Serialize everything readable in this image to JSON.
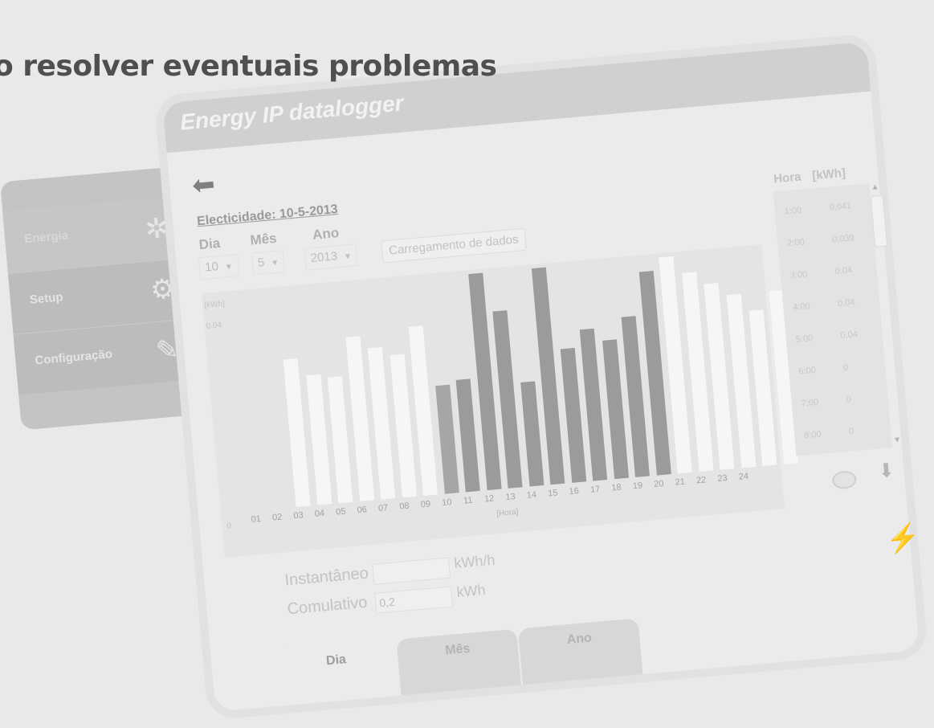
{
  "heading": "o resolver eventuais problemas",
  "app": {
    "title": "Energy IP datalogger",
    "back_icon": "back-arrow-icon"
  },
  "sidebar": {
    "items": [
      {
        "label": "Energia",
        "icon": "energy-icon"
      },
      {
        "label": "Setup",
        "icon": "gear-icon"
      },
      {
        "label": "Configuração",
        "icon": "pencil-icon"
      }
    ]
  },
  "header": {
    "title": "Electicidade: 10-5-2013"
  },
  "selectors": {
    "day_label": "Dia",
    "day_value": "10",
    "month_label": "Mês",
    "month_value": "5",
    "year_label": "Ano",
    "year_value": "2013",
    "load_button": "Carregamento de dados"
  },
  "chart_data": {
    "type": "bar",
    "ylabel": "[kWh]",
    "xlabel": "[Hora]",
    "y_ticks": [
      "0",
      "0.04"
    ],
    "ylim": [
      0,
      0.05
    ],
    "categories": [
      "01",
      "02",
      "03",
      "04",
      "05",
      "06",
      "07",
      "08",
      "09",
      "10",
      "11",
      "12",
      "13",
      "14",
      "15",
      "16",
      "17",
      "18",
      "19",
      "20",
      "21",
      "22",
      "23",
      "24"
    ],
    "values": [
      0.034,
      0.03,
      0.029,
      0.038,
      0.035,
      0.033,
      0.039,
      0.025,
      0.026,
      0.05,
      0.041,
      0.024,
      0.05,
      0.031,
      0.035,
      0.032,
      0.037,
      0.047,
      0.05,
      0.046,
      0.043,
      0.04,
      0.036,
      0.04
    ],
    "bar_tones": [
      "light",
      "light",
      "light",
      "light",
      "light",
      "light",
      "light",
      "mid",
      "dark",
      "dark",
      "dark",
      "dark",
      "dark",
      "dark",
      "dark",
      "dark",
      "dark",
      "dark",
      "light",
      "light",
      "light",
      "light",
      "light",
      "light"
    ]
  },
  "table": {
    "header_time": "Hora",
    "header_value": "[kWh]",
    "rows": [
      {
        "time": "1:00",
        "value": "0,041"
      },
      {
        "time": "2:00",
        "value": "0,039"
      },
      {
        "time": "3:00",
        "value": "0,04"
      },
      {
        "time": "4:00",
        "value": "0,04"
      },
      {
        "time": "5:00",
        "value": "0,04"
      },
      {
        "time": "6:00",
        "value": "0"
      },
      {
        "time": "7:00",
        "value": "0"
      },
      {
        "time": "8:00",
        "value": "0"
      }
    ]
  },
  "fields": {
    "instant_label": "Instantâneo",
    "instant_value": "",
    "instant_unit": "kWh/h",
    "cumulative_label": "Comulativo",
    "cumulative_value": "0,2",
    "cumulative_unit": "kWh"
  },
  "tabs": [
    "Dia",
    "Mês",
    "Ano"
  ]
}
